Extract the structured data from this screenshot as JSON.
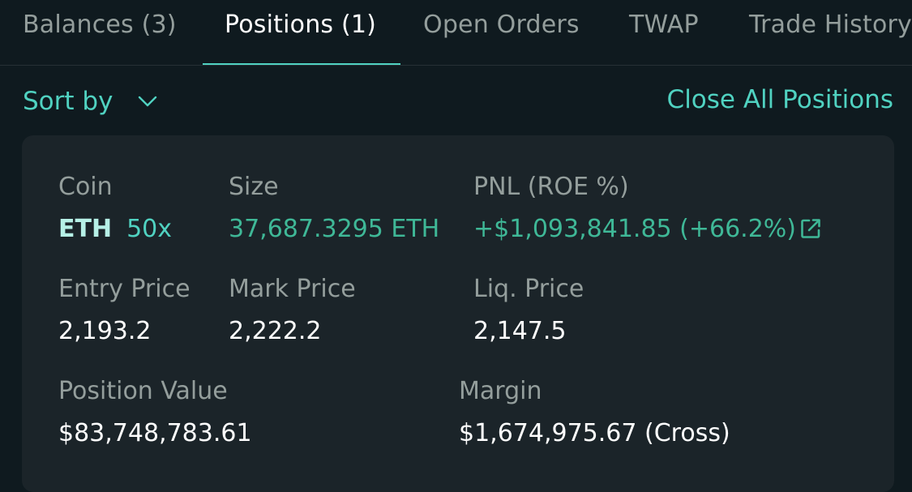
{
  "tabs": [
    {
      "label": "Balances (3)"
    },
    {
      "label": "Positions (1)",
      "active": true
    },
    {
      "label": "Open Orders"
    },
    {
      "label": "TWAP"
    },
    {
      "label": "Trade History"
    }
  ],
  "toolbar": {
    "sort_label": "Sort by",
    "close_all_label": "Close All Positions"
  },
  "position": {
    "coin_label": "Coin",
    "coin": "ETH",
    "leverage": "50x",
    "size_label": "Size",
    "size": "37,687.3295 ETH",
    "pnl_label": "PNL (ROE %)",
    "pnl": "+$1,093,841.85 (+66.2%)",
    "entry_label": "Entry Price",
    "entry": "2,193.2",
    "mark_label": "Mark Price",
    "mark": "2,222.2",
    "liq_label": "Liq. Price",
    "liq": "2,147.5",
    "value_label": "Position Value",
    "value": "$83,748,783.61",
    "margin_label": "Margin",
    "margin": "$1,674,975.67 (Cross)"
  },
  "icons": {
    "sort": "chevron-down-icon",
    "pnl_share": "external-link-icon"
  },
  "colors": {
    "background": "#0f1a1f",
    "card": "#1b2429",
    "accent": "#50d2c1",
    "positive": "#3fb897",
    "muted": "#949e9c"
  }
}
